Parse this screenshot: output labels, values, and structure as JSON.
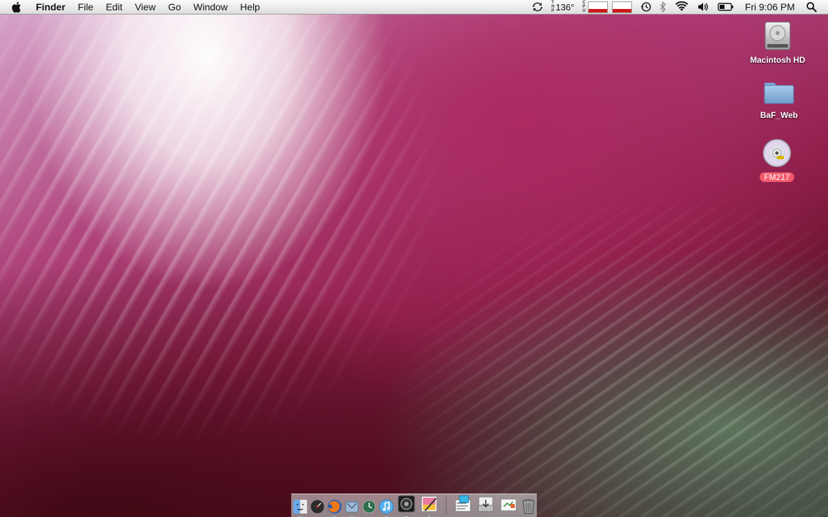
{
  "menubar": {
    "app_name": "Finder",
    "menus": [
      "File",
      "Edit",
      "View",
      "Go",
      "Window",
      "Help"
    ],
    "temperature": "136°",
    "temp_stack": [
      "T",
      "H",
      "P"
    ],
    "cpu_stack": [
      "C",
      "P",
      "U"
    ],
    "clock": "Fri 9:06 PM"
  },
  "desktop_icons": [
    {
      "label": "Macintosh HD",
      "icon": "hard-drive-icon"
    },
    {
      "label": "BaF_Web",
      "icon": "folder-icon"
    },
    {
      "label": "FM217",
      "icon": "dvd-icon",
      "selected": true
    }
  ],
  "dock": {
    "items": [
      {
        "icon": "finder-icon",
        "running": true
      },
      {
        "icon": "dashboard-icon",
        "running": false
      },
      {
        "icon": "firefox-icon",
        "running": true
      },
      {
        "icon": "mail-icon",
        "running": true
      },
      {
        "icon": "time-machine-icon",
        "running": false
      },
      {
        "icon": "itunes-icon",
        "running": true
      },
      {
        "icon": "aperture-icon",
        "running": true
      },
      {
        "icon": "textedit-icon",
        "running": true
      },
      {
        "icon": "preview-icon",
        "running": false
      },
      {
        "icon": "downloads-stack-icon",
        "running": false
      },
      {
        "icon": "documents-stack-icon",
        "running": false
      },
      {
        "icon": "trash-icon",
        "running": false
      }
    ]
  },
  "colors": {
    "selected_label_bg": "#f05a6a",
    "meter_fill": "#d01818"
  }
}
